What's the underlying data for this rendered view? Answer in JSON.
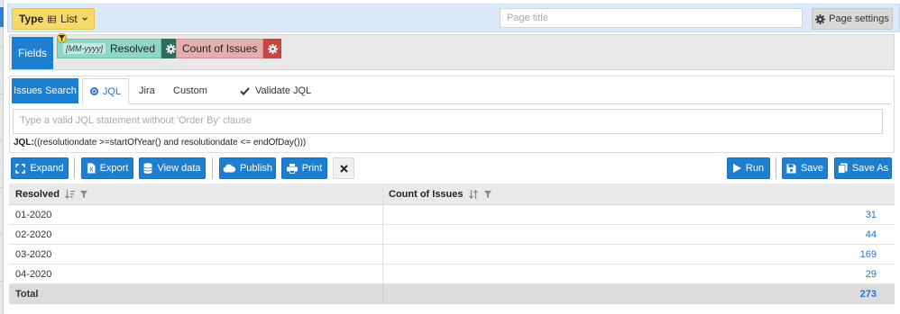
{
  "topbar": {
    "type_label": "Type",
    "type_value": "List",
    "page_title_placeholder": "Page title",
    "page_settings_label": "Page settings"
  },
  "fields": {
    "label": "Fields",
    "chips": [
      {
        "format": "[MM-yyyy]",
        "label": "Resolved",
        "color": "#8ed7c5"
      },
      {
        "label": "Count of Issues",
        "color": "#e5aeae"
      }
    ]
  },
  "search": {
    "issues_search_label": "Issues Search",
    "tabs": [
      "JQL",
      "Jira",
      "Custom"
    ],
    "validate_label": "Validate JQL",
    "jql_placeholder": "Type a valid JQL statement without 'Order By' clause",
    "jql_prefix": "JQL:",
    "jql_text": "((resolutiondate >=startOfYear() and resolutiondate <= endOfDay()))"
  },
  "toolbar": {
    "expand": "Expand",
    "export": "Export",
    "view_data": "View data",
    "publish": "Publish",
    "print": "Print",
    "run": "Run",
    "save": "Save",
    "save_as": "Save As"
  },
  "table": {
    "headers": [
      "Resolved",
      "Count of Issues"
    ],
    "rows": [
      [
        "01-2020",
        "31"
      ],
      [
        "02-2020",
        "44"
      ],
      [
        "03-2020",
        "169"
      ],
      [
        "04-2020",
        "29"
      ]
    ],
    "total_label": "Total",
    "total_value": "273"
  },
  "colors": {
    "primary": "#1e7fd0",
    "type_button": "#f7d96b",
    "link_number": "#2a74c2"
  }
}
